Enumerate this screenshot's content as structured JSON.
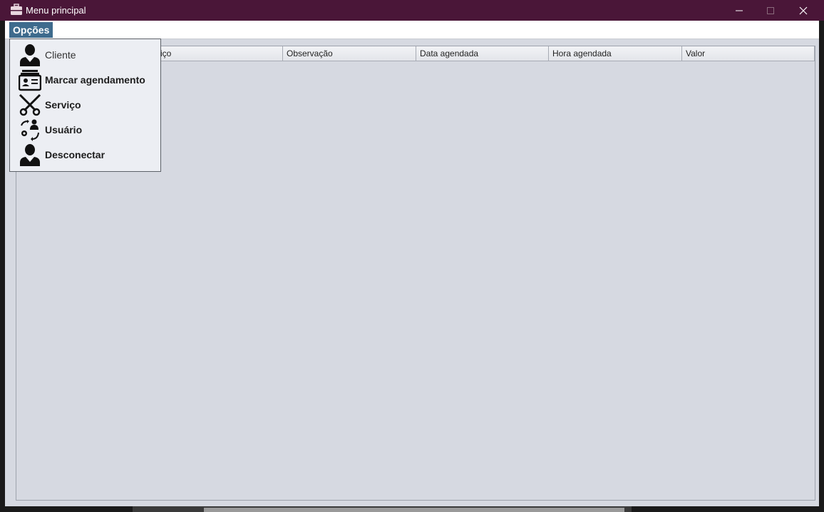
{
  "window": {
    "title": "Menu principal",
    "app_icon": "briefcase-icon",
    "controls": [
      "minimize-icon",
      "maximize-icon",
      "close-icon"
    ],
    "colors": {
      "titlebar": "#4a1638",
      "menu_selected": "#3e6b8d",
      "background": "#d6d9e1"
    }
  },
  "menubar": {
    "opcoes_label": "Opções"
  },
  "dropdown": {
    "items": [
      {
        "label": "Cliente",
        "icon": "user-icon"
      },
      {
        "label": "Marcar agendamento",
        "icon": "id-card-icon"
      },
      {
        "label": "Serviço",
        "icon": "scissors-icon"
      },
      {
        "label": "Usuário",
        "icon": "user-sync-icon"
      },
      {
        "label": "Desconectar",
        "icon": "user-icon"
      }
    ]
  },
  "table": {
    "columns": [
      "",
      "rviço",
      "Observação",
      "Data agendada",
      "Hora agendada",
      "Valor"
    ],
    "rows": []
  }
}
